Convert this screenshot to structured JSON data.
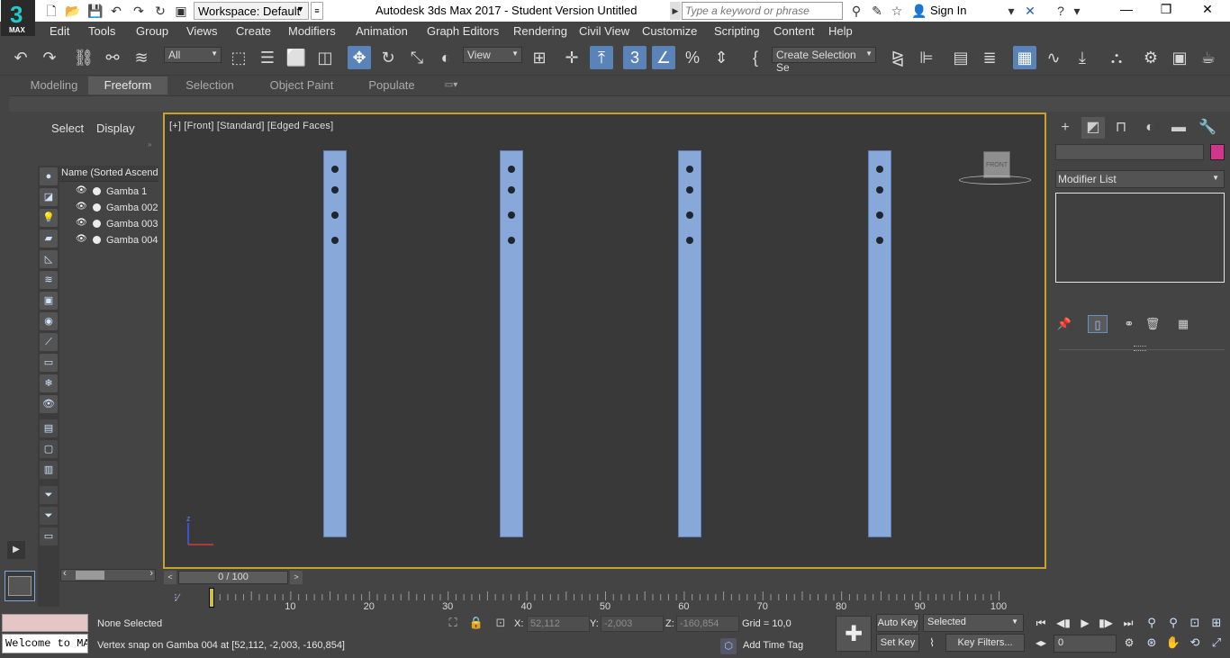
{
  "titlebar": {
    "logo_big": "3",
    "logo_small": "MAX",
    "workspace": "Workspace: Default",
    "app_title": "Autodesk 3ds Max 2017 - Student Version    Untitled",
    "search_placeholder": "Type a keyword or phrase",
    "sign_in": "Sign In"
  },
  "menubar": {
    "items": [
      "Edit",
      "Tools",
      "Group",
      "Views",
      "Create",
      "Modifiers",
      "Animation",
      "Graph Editors",
      "Rendering",
      "Civil View",
      "Customize",
      "Scripting",
      "Content",
      "Help"
    ]
  },
  "toolbar": {
    "filter": "All",
    "refcoord": "View",
    "selection_set": "Create Selection Se",
    "snap_label": "3"
  },
  "ribbon": {
    "tabs": [
      "Modeling",
      "Freeform",
      "Selection",
      "Object Paint",
      "Populate"
    ],
    "active": "Freeform"
  },
  "explorer": {
    "tabs": [
      "Select",
      "Display"
    ],
    "header": "Name (Sorted Ascending)",
    "objects": [
      "Gamba 1",
      "Gamba 002",
      "Gamba 003",
      "Gamba 004"
    ]
  },
  "viewport": {
    "label": "[+] [Front] [Standard] [Edged Faces]",
    "viewcube_label": "FRONT",
    "axis_z": "z",
    "colors": {
      "border": "#c8a32a",
      "object": "#87a8d9"
    }
  },
  "cmdpanel": {
    "modifier_list": "Modifier List",
    "object_color": "#d0368b"
  },
  "timeslider": {
    "position": "0 / 100",
    "ticks": [
      10,
      20,
      30,
      40,
      50,
      60,
      70,
      80,
      90,
      100
    ]
  },
  "status": {
    "maxscript": "Welcome to MAXScript.",
    "selection": "None Selected",
    "prompt": "Vertex snap on Gamba 004 at [52,112, -2,003, -160,854]",
    "x_label": "X:",
    "x_value": "52,112",
    "y_label": "Y:",
    "y_value": "-2,003",
    "z_label": "Z:",
    "z_value": "-160,854",
    "grid": "Grid = 10,0",
    "add_time_tag": "Add Time Tag",
    "auto_key": "Auto Key",
    "set_key": "Set Key",
    "key_mode": "Selected",
    "key_filters": "Key Filters...",
    "frame": "0"
  }
}
